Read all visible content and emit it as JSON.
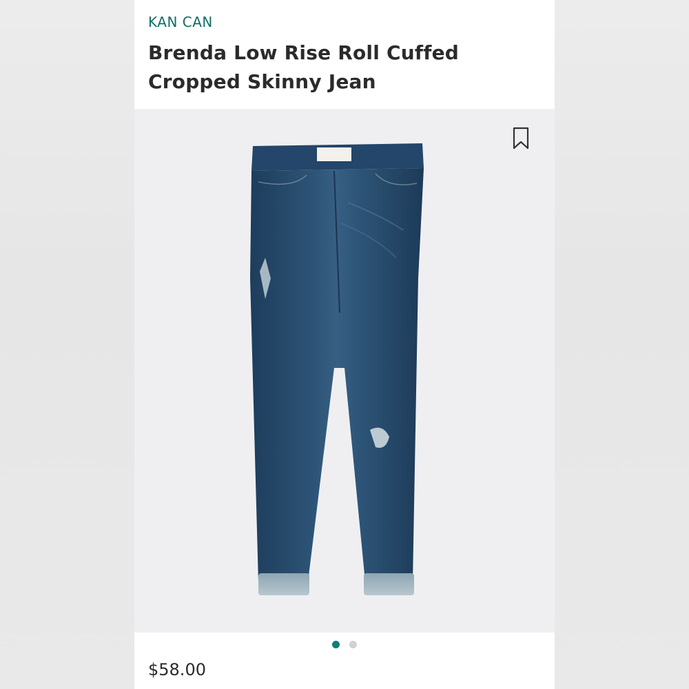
{
  "product": {
    "brand": "KAN CAN",
    "title": "Brenda Low Rise Roll Cuffed Cropped Skinny Jean",
    "price": "$58.00",
    "image_alt": "dark wash distressed cropped skinny jeans with rolled cuffs"
  },
  "carousel": {
    "total_images": 2,
    "active_index": 0
  },
  "icons": {
    "bookmark": "bookmark-icon"
  },
  "colors": {
    "brand": "#0f6e67",
    "active_dot": "#0f7d78",
    "inactive_dot": "#cfd1d3",
    "denim": "#274a6b"
  }
}
